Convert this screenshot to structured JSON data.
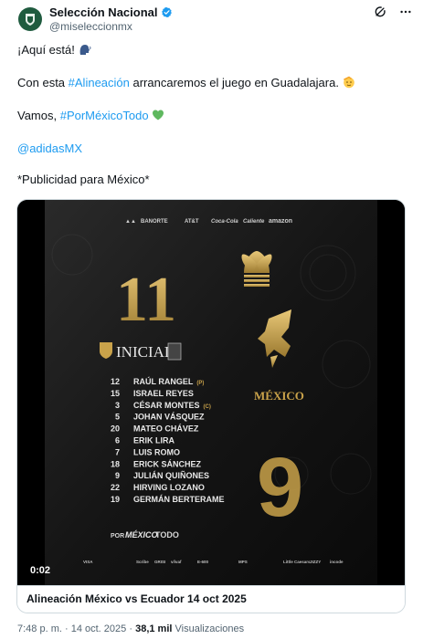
{
  "author": {
    "name": "Selección Nacional",
    "handle": "@miseleccionmx"
  },
  "tweet": {
    "line1": "¡Aquí está!",
    "line2_before": "Con esta ",
    "line2_hashtag": "#Alineación",
    "line2_after": " arrancaremos el juego en Guadalajara.",
    "line3_before": "Vamos, ",
    "line3_hashtag": "#PorMéxicoTodo",
    "mention": "@adidasMX",
    "disclaimer": "*Publicidad para México*"
  },
  "media": {
    "video_time": "0:02",
    "sponsors_top": [
      "BANORTE",
      "AT&T",
      "Coca-Cola",
      "Caliente",
      "amazon"
    ],
    "lineup_number": "11",
    "lineup_title": "INICIAL",
    "crest_text": "MÉXICO",
    "shirt_number": "9",
    "players": [
      {
        "number": "12",
        "name": "RAÚL RANGEL",
        "tag": "(P)"
      },
      {
        "number": "15",
        "name": "ISRAEL REYES",
        "tag": ""
      },
      {
        "number": "3",
        "name": "CÉSAR MONTES",
        "tag": "(C)"
      },
      {
        "number": "5",
        "name": "JOHAN VÁSQUEZ",
        "tag": ""
      },
      {
        "number": "20",
        "name": "MATEO CHÁVEZ",
        "tag": ""
      },
      {
        "number": "6",
        "name": "ERIK LIRA",
        "tag": ""
      },
      {
        "number": "7",
        "name": "LUIS ROMO",
        "tag": ""
      },
      {
        "number": "18",
        "name": "ERICK SÁNCHEZ",
        "tag": ""
      },
      {
        "number": "9",
        "name": "JULIÁN QUIÑONES",
        "tag": ""
      },
      {
        "number": "22",
        "name": "HIRVING LOZANO",
        "tag": ""
      },
      {
        "number": "19",
        "name": "GERMÁN BERTERAME",
        "tag": ""
      }
    ],
    "slogan_pre": "POR",
    "slogan_mid": "MÉXICO",
    "slogan_post": "TODO",
    "sponsors_bottom": [
      "VISA",
      "Scribe",
      "GRISI",
      "v/ivaf",
      "E-600",
      "MPS",
      "Little Caesars",
      "JIZZY",
      "incode"
    ]
  },
  "card": {
    "title": "Alineación México vs Ecuador 14 oct 2025"
  },
  "meta": {
    "time": "7:48 p. m.",
    "date": "14 oct. 2025",
    "views_count": "38,1 mil",
    "views_label": "Visualizaciones"
  },
  "colors": {
    "link": "#1d9bf0",
    "gold": "#c9a24a",
    "avatar_bg": "#1f5b3f"
  }
}
